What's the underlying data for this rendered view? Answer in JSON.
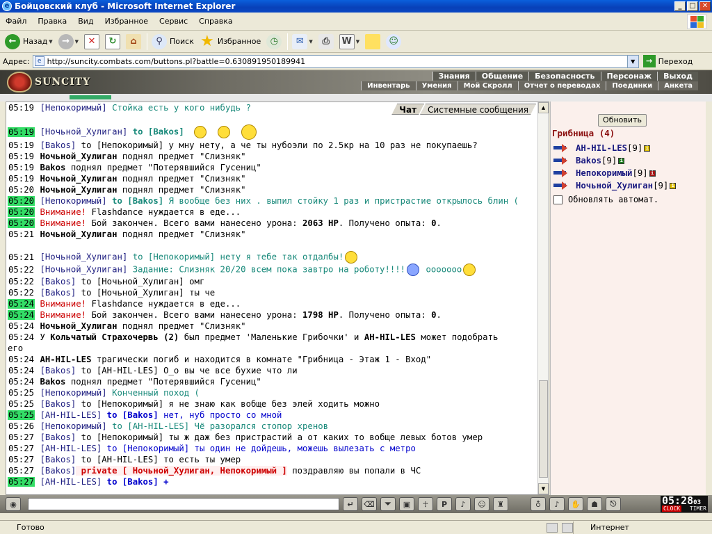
{
  "window": {
    "title": "Бойцовский клуб - Microsoft Internet Explorer"
  },
  "menu": [
    "Файл",
    "Правка",
    "Вид",
    "Избранное",
    "Сервис",
    "Справка"
  ],
  "toolbar": {
    "back": "Назад",
    "search": "Поиск",
    "favorites": "Избранное"
  },
  "address": {
    "label": "Адрес:",
    "url": "http://suncity.combats.com/buttons.pl?battle=0.630891950189941",
    "go": "Переход"
  },
  "game": {
    "logo": "SUNCITY",
    "nav_top": [
      "Знания",
      "Общение",
      "Безопасность",
      "Персонаж",
      "Выход"
    ],
    "nav_sub": [
      "Инвентарь",
      "Умения",
      "Мой Скролл",
      "Отчет о переводах",
      "Поединки",
      "Анкета"
    ]
  },
  "chat": {
    "tabs": [
      "Чат",
      "Системные сообщения"
    ],
    "lines": [
      {
        "ts": "05:19",
        "parts": [
          {
            "t": "[Непокоримый]",
            "c": "nick"
          },
          {
            "t": " Стойка есть у кого нибудь ?",
            "c": "g"
          }
        ]
      },
      {
        "ts": "05:19",
        "hl": true,
        "parts": [
          {
            "t": "[Ночьной_Хулиган]",
            "c": "nick"
          },
          {
            "t": " to [Bakos]",
            "c": "g b"
          }
        ]
      },
      {
        "ts": "05:19",
        "parts": [
          {
            "t": "[Bakos]",
            "c": "nick"
          },
          {
            "t": " to [Непокоримый] у мну нету, а че ты нубоэли по 2.5кр на 10 раз не покупаешь?",
            "c": ""
          }
        ]
      },
      {
        "ts": "05:19",
        "parts": [
          {
            "t": "Ночьной_Хулиган",
            "c": "b"
          },
          {
            "t": " поднял предмет \"Слизняк\"",
            "c": ""
          }
        ]
      },
      {
        "ts": "05:19",
        "parts": [
          {
            "t": "Bakos",
            "c": "b"
          },
          {
            "t": " поднял предмет \"Потерявшийся Гусениц\"",
            "c": ""
          }
        ]
      },
      {
        "ts": "05:19",
        "parts": [
          {
            "t": "Ночьной_Хулиган",
            "c": "b"
          },
          {
            "t": " поднял предмет \"Слизняк\"",
            "c": ""
          }
        ]
      },
      {
        "ts": "05:20",
        "parts": [
          {
            "t": "Ночьной_Хулиган",
            "c": "b"
          },
          {
            "t": " поднял предмет \"Слизняк\"",
            "c": ""
          }
        ]
      },
      {
        "ts": "05:20",
        "hl": true,
        "parts": [
          {
            "t": "[Непокоримый]",
            "c": "nick"
          },
          {
            "t": " to [Bakos]",
            "c": "g b"
          },
          {
            "t": " Я вообще без них . выпил стойку 1 раз и пристрастие открылось блин (",
            "c": "g"
          }
        ]
      },
      {
        "ts": "05:20",
        "hl": true,
        "parts": [
          {
            "t": "Внимание!",
            "c": "r"
          },
          {
            "t": " Flashdance нуждается в еде...",
            "c": ""
          }
        ]
      },
      {
        "ts": "05:20",
        "hl": true,
        "parts": [
          {
            "t": "Внимание!",
            "c": "r"
          },
          {
            "t": " Бой закончен. Всего вами нанесено урона: ",
            "c": ""
          },
          {
            "t": "2063 HP",
            "c": "b"
          },
          {
            "t": ". Получено опыта: ",
            "c": ""
          },
          {
            "t": "0",
            "c": "b"
          },
          {
            "t": ".",
            "c": ""
          }
        ]
      },
      {
        "ts": "05:21",
        "parts": [
          {
            "t": "Ночьной_Хулиган",
            "c": "b"
          },
          {
            "t": " поднял предмет \"Слизняк\"",
            "c": ""
          }
        ]
      },
      {
        "ts": "05:21",
        "parts": [
          {
            "t": "[Ночьной_Хулиган]",
            "c": "nick"
          },
          {
            "t": " to [Непокоримый] нету я тебе так отдалбы!",
            "c": "g"
          }
        ]
      },
      {
        "ts": "05:22",
        "parts": [
          {
            "t": "[Ночьной_Хулиган]",
            "c": "nick"
          },
          {
            "t": " Задание: Слизняк 20/20 всем пока завтро на роботу!!!!",
            "c": "g"
          },
          {
            "t": " ооооооо",
            "c": "g"
          }
        ]
      },
      {
        "ts": "05:22",
        "parts": [
          {
            "t": "[Bakos]",
            "c": "nick"
          },
          {
            "t": " to [Ночьной_Хулиган] омг",
            "c": ""
          }
        ]
      },
      {
        "ts": "05:22",
        "parts": [
          {
            "t": "[Bakos]",
            "c": "nick"
          },
          {
            "t": " to [Ночьной_Хулиган] ты че",
            "c": ""
          }
        ]
      },
      {
        "ts": "05:24",
        "hl": true,
        "parts": [
          {
            "t": "Внимание!",
            "c": "r"
          },
          {
            "t": " Flashdance нуждается в еде...",
            "c": ""
          }
        ]
      },
      {
        "ts": "05:24",
        "hl": true,
        "parts": [
          {
            "t": "Внимание!",
            "c": "r"
          },
          {
            "t": " Бой закончен. Всего вами нанесено урона: ",
            "c": ""
          },
          {
            "t": "1798 HP",
            "c": "b"
          },
          {
            "t": ". Получено опыта: ",
            "c": ""
          },
          {
            "t": "0",
            "c": "b"
          },
          {
            "t": ".",
            "c": ""
          }
        ]
      },
      {
        "ts": "05:24",
        "parts": [
          {
            "t": "Ночьной_Хулиган",
            "c": "b"
          },
          {
            "t": " поднял предмет \"Слизняк\"",
            "c": ""
          }
        ]
      },
      {
        "ts": "05:24",
        "parts": [
          {
            "t": "У ",
            "c": ""
          },
          {
            "t": "Кольчатый Страхочервь (2)",
            "c": "b"
          },
          {
            "t": " был предмет 'Маленькие Грибочки' и ",
            "c": ""
          },
          {
            "t": "AH-HIL-LES",
            "c": "b"
          },
          {
            "t": " может подобрать",
            "c": ""
          }
        ]
      },
      {
        "ts": "",
        "parts": [
          {
            "t": "его",
            "c": ""
          }
        ]
      },
      {
        "ts": "05:24",
        "parts": [
          {
            "t": "AH-HIL-LES",
            "c": "b"
          },
          {
            "t": " трагически погиб и находится в комнате \"Грибница - Этаж 1 - Вход\"",
            "c": ""
          }
        ]
      },
      {
        "ts": "05:24",
        "parts": [
          {
            "t": "[Bakos]",
            "c": "nick"
          },
          {
            "t": " to [AH-HIL-LES] О_о вы че все бухие что ли",
            "c": ""
          }
        ]
      },
      {
        "ts": "05:24",
        "parts": [
          {
            "t": "Bakos",
            "c": "b"
          },
          {
            "t": " поднял предмет \"Потерявшийся Гусениц\"",
            "c": ""
          }
        ]
      },
      {
        "ts": "05:25",
        "parts": [
          {
            "t": "[Непокоримый]",
            "c": "nick"
          },
          {
            "t": " Конченный поход (",
            "c": "g"
          }
        ]
      },
      {
        "ts": "05:25",
        "parts": [
          {
            "t": "[Bakos]",
            "c": "nick"
          },
          {
            "t": " to [Непокоримый] я не знаю как вобще без элей ходить можно",
            "c": ""
          }
        ]
      },
      {
        "ts": "05:25",
        "hl": true,
        "parts": [
          {
            "t": "[AH-HIL-LES]",
            "c": "nick"
          },
          {
            "t": " to [Bakos]",
            "c": "blue b"
          },
          {
            "t": " нет, нуб просто со мной",
            "c": "blue"
          }
        ]
      },
      {
        "ts": "05:26",
        "parts": [
          {
            "t": "[Непокоримый]",
            "c": "nick"
          },
          {
            "t": " to [AH-HIL-LES] Чё разорался стопор хренов",
            "c": "g"
          }
        ]
      },
      {
        "ts": "05:27",
        "parts": [
          {
            "t": "[Bakos]",
            "c": "nick"
          },
          {
            "t": " to [Непокоримый] ты ж даж без пристрастий а от каких то вобще левых ботов умер",
            "c": ""
          }
        ]
      },
      {
        "ts": "05:27",
        "parts": [
          {
            "t": "[AH-HIL-LES]",
            "c": "nick"
          },
          {
            "t": " to [Непокоримый] ты один не дойдешь, можешь вылезать с метро",
            "c": "blue"
          }
        ]
      },
      {
        "ts": "05:27",
        "parts": [
          {
            "t": "[Bakos]",
            "c": "nick"
          },
          {
            "t": " to [AH-HIL-LES] то есть ты умер",
            "c": ""
          }
        ]
      },
      {
        "ts": "05:27",
        "parts": [
          {
            "t": "[Bakos]",
            "c": "nick"
          },
          {
            "t": " private [ Ночьной_Хулиган, Непокоримый ]",
            "c": "pvt"
          },
          {
            "t": " поздравляю вы попали в ЧС",
            "c": ""
          }
        ]
      },
      {
        "ts": "05:27",
        "hl": true,
        "parts": [
          {
            "t": "[AH-HIL-LES]",
            "c": "nick"
          },
          {
            "t": " to [Bakos]",
            "c": "blue b"
          },
          {
            "t": " +",
            "c": "blue b"
          }
        ]
      }
    ]
  },
  "room": {
    "refresh": "Обновить",
    "name": "Грибница (4)",
    "users": [
      {
        "name": "AH-HIL-LES",
        "level": "[9]",
        "badge_color": "#e0c000"
      },
      {
        "name": "Bakos",
        "level": "[9]",
        "badge_color": "#208020"
      },
      {
        "name": "Непокоримый",
        "level": "[9]",
        "badge_color": "#a01010"
      },
      {
        "name": "Ночьной_Хулиган",
        "level": "[9]",
        "badge_color": "#e0c000"
      }
    ],
    "auto_refresh": "Обновлять автомат."
  },
  "clock": {
    "time": "05:28",
    "seconds": "03",
    "clock_label": "CLOCK",
    "timer_label": "TIMER"
  },
  "status": {
    "text": "Готово",
    "zone": "Интернет"
  }
}
